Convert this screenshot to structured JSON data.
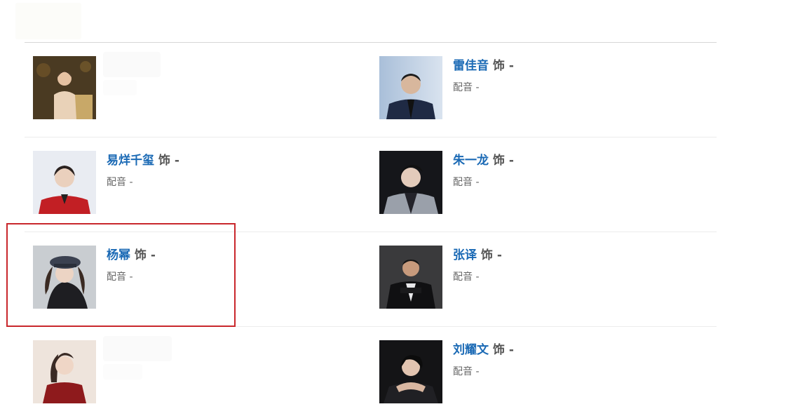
{
  "cast": [
    {
      "actor": "",
      "role_connector": "",
      "role": "",
      "subtitle": "",
      "dub_value": "",
      "blurred": true
    },
    {
      "actor": "雷佳音",
      "role_connector": "饰",
      "role": "-",
      "subtitle": "配音",
      "dub_value": "-",
      "blurred": false
    },
    {
      "actor": "易烊千玺",
      "role_connector": "饰",
      "role": "-",
      "subtitle": "配音",
      "dub_value": "-",
      "blurred": false
    },
    {
      "actor": "朱一龙",
      "role_connector": "饰",
      "role": "-",
      "subtitle": "配音",
      "dub_value": "-",
      "blurred": false
    },
    {
      "actor": "杨幂",
      "role_connector": "饰",
      "role": "-",
      "subtitle": "配音",
      "dub_value": "-",
      "blurred": false
    },
    {
      "actor": "张译",
      "role_connector": "饰",
      "role": "-",
      "subtitle": "配音",
      "dub_value": "-",
      "blurred": false
    },
    {
      "actor": "",
      "role_connector": "",
      "role": "",
      "subtitle": "",
      "dub_value": "",
      "blurred": true
    },
    {
      "actor": "刘耀文",
      "role_connector": "饰",
      "role": "-",
      "subtitle": "配音",
      "dub_value": "-",
      "blurred": false
    }
  ],
  "colors": {
    "actor_link": "#1b6ab5",
    "highlight_border": "#c9272c"
  }
}
